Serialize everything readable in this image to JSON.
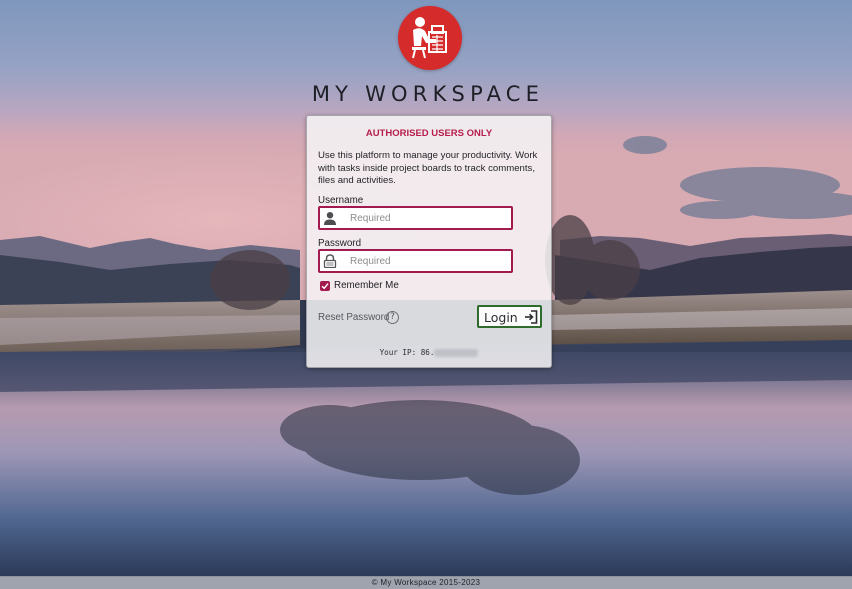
{
  "app": {
    "title": "MY WORKSPACE",
    "logo_icon": "person-at-desk-icon",
    "logo_color": "#d52b2b"
  },
  "login": {
    "notice": "AUTHORISED USERS ONLY",
    "intro": "Use this platform to manage your productivity. Work with tasks inside project boards to track comments, files and activities.",
    "username_label": "Username",
    "username_placeholder": "Required",
    "username_value": "",
    "password_label": "Password",
    "password_placeholder": "Required",
    "password_value": "",
    "remember_label": "Remember Me",
    "remember_checked": true,
    "reset_label": "Reset Password",
    "help_glyph": "?",
    "login_label": "Login",
    "ip_label": "Your IP: 86.",
    "accent_color": "#a31a4e",
    "button_border_color": "#2f6b2c"
  },
  "footer": {
    "text": "©  My Workspace 2015-2023"
  }
}
